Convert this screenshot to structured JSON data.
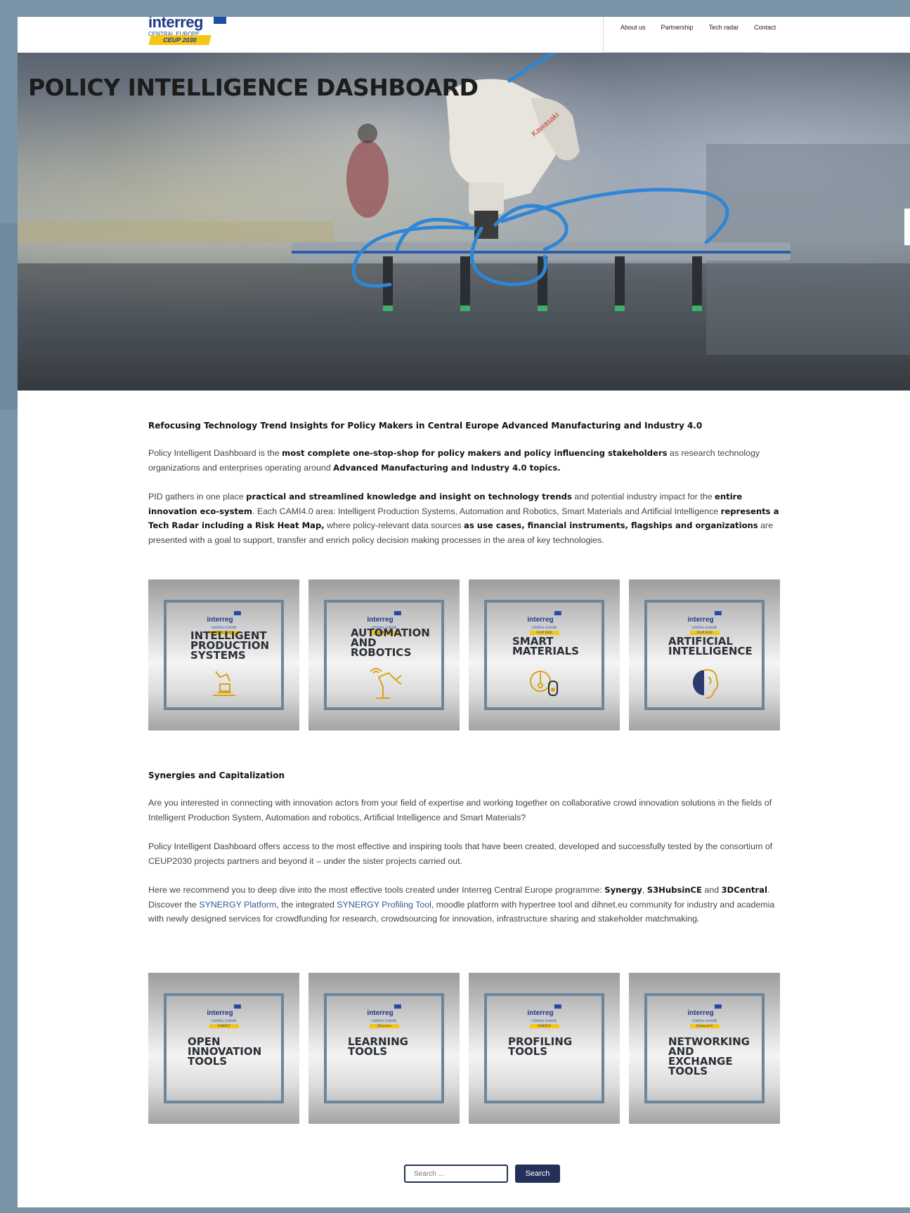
{
  "logo": {
    "brand": "interreg",
    "sub": "CENTRAL EUROPE",
    "tag": "CEUP 2030"
  },
  "nav": [
    "About us",
    "Partnership",
    "Tech radar",
    "Contact"
  ],
  "hero": {
    "title": "POLICY INTELLIGENCE DASHBOARD"
  },
  "intro": {
    "heading": "Refocusing Technology Trend Insights for Policy Makers in Central Europe Advanced Manufacturing and Industry 4.0",
    "p1": [
      {
        "t": "Policy Intelligent Dashboard is the "
      },
      {
        "t": "most complete one-stop-shop for policy makers and policy influencing stakeholders",
        "b": true
      },
      {
        "t": " as research technology organizations and enterprises operating around "
      },
      {
        "t": "Advanced Manufacturing and Industry 4.0 topics.",
        "b": true
      }
    ],
    "p2": [
      {
        "t": "PID gathers in one place "
      },
      {
        "t": "practical and streamlined knowledge and insight on technology trends",
        "b": true
      },
      {
        "t": " and potential industry impact for the "
      },
      {
        "t": "entire innovation eco-system",
        "b": true
      },
      {
        "t": ". Each CAMI4.0 area: Intelligent Production Systems, Automation and Robotics, Smart Materials and Artificial Intelligence "
      },
      {
        "t": "represents a Tech Radar including a Risk Heat Map,",
        "b": true
      },
      {
        "t": " where policy-relevant data sources "
      },
      {
        "t": "as use cases, financial instruments, flagships and organizations",
        "b": true
      },
      {
        "t": " are presented with a goal to support, transfer and enrich policy decision making processes in the area of key technologies."
      }
    ]
  },
  "area_tiles": [
    {
      "label": "INTELLIGENT\nPRODUCTION\nSYSTEMS",
      "icon": "production-icon",
      "tag": "CEUP 2030"
    },
    {
      "label": "AUTOMATION\nAND\nROBOTICS",
      "icon": "robot-arm-icon",
      "tag": "CEUP 2030"
    },
    {
      "label": "SMART\nMATERIALS",
      "icon": "materials-icon",
      "tag": "CEUP 2030"
    },
    {
      "label": "ARTIFICIAL\nINTELLIGENCE",
      "icon": "brain-icon",
      "tag": "CEUP 2030"
    }
  ],
  "synergies": {
    "heading": "Synergies and Capitalization",
    "p1": "Are you interested in connecting with innovation actors from your field of expertise and working together on collaborative crowd innovation solutions in the fields of Intelligent Production System, Automation and robotics, Artificial Intelligence and Smart Materials?",
    "p2": "Policy Intelligent Dashboard offers access to the most effective and inspiring tools that have been created, developed and successfully tested by the consortium of CEUP2030 projects partners and beyond it – under the sister projects carried out.",
    "p3": [
      {
        "t": "Here we recommend you to deep dive into the most effective tools created under Interreg Central Europe programme: "
      },
      {
        "t": "Synergy",
        "b": true
      },
      {
        "t": ", "
      },
      {
        "t": "S3HubsinCE",
        "b": true
      },
      {
        "t": " and "
      },
      {
        "t": "3DCentral",
        "b": true
      },
      {
        "t": ". Discover the "
      },
      {
        "t": "SYNERGY Platform",
        "l": true
      },
      {
        "t": ", the integrated "
      },
      {
        "t": "SYNERGY Profiling Tool",
        "l": true
      },
      {
        "t": ", moodle platform with hypertree tool and dihnet.eu community for industry and academia with newly designed services for crowdfunding for research, crowdsourcing for innovation, infrastructure sharing and stakeholder matchmaking."
      }
    ]
  },
  "tool_tiles": [
    {
      "label": "OPEN\nINNOVATION\nTOOLS",
      "tag": "SYNERGY"
    },
    {
      "label": "LEARNING\nTOOLS",
      "tag": "3DCentral"
    },
    {
      "label": "PROFILING\nTOOLS",
      "tag": "SYNERGY"
    },
    {
      "label": "NETWORKING\nAND\nEXCHANGE\nTOOLS",
      "tag": "S3HubsinCE"
    }
  ],
  "search": {
    "placeholder": "Search ...",
    "button": "Search"
  },
  "colors": {
    "frame": "#7a93a6",
    "tile_border": "#6c8599",
    "navy": "#233159",
    "accent_yellow": "#f5c518"
  }
}
